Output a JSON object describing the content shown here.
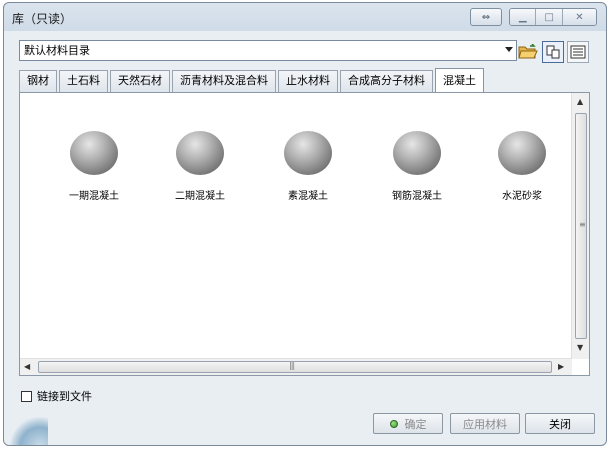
{
  "window": {
    "title": "库（只读）",
    "restore_icon": "swap-arrows-icon",
    "controls": [
      "minimize-icon",
      "maximize-icon",
      "close-icon"
    ]
  },
  "toolbar": {
    "catalog_select": {
      "value": "默认材料目录"
    },
    "open_icon": "folder-open-icon",
    "view_icons": [
      "icon-view-icon",
      "list-view-icon"
    ]
  },
  "tabs": [
    {
      "label": "钢材",
      "active": false
    },
    {
      "label": "土石料",
      "active": false
    },
    {
      "label": "天然石材",
      "active": false
    },
    {
      "label": "沥青材料及混合料",
      "active": false
    },
    {
      "label": "止水材料",
      "active": false
    },
    {
      "label": "合成高分子材料",
      "active": false
    },
    {
      "label": "混凝土",
      "active": true
    }
  ],
  "materials": [
    {
      "label": "一期混凝土",
      "icon": "sphere-icon"
    },
    {
      "label": "二期混凝土",
      "icon": "sphere-icon"
    },
    {
      "label": "素混凝土",
      "icon": "sphere-icon"
    },
    {
      "label": "钢筋混凝土",
      "icon": "sphere-icon"
    },
    {
      "label": "水泥砂浆",
      "icon": "sphere-icon"
    }
  ],
  "link_to_file": {
    "label": "链接到文件",
    "checked": false
  },
  "buttons": {
    "ok": "确定",
    "apply": "应用材料",
    "close": "关闭"
  },
  "colors": {
    "status_dot": "#3a9a2a",
    "panel_bg": "#ffffff",
    "window_bg": "#e9eef3"
  }
}
